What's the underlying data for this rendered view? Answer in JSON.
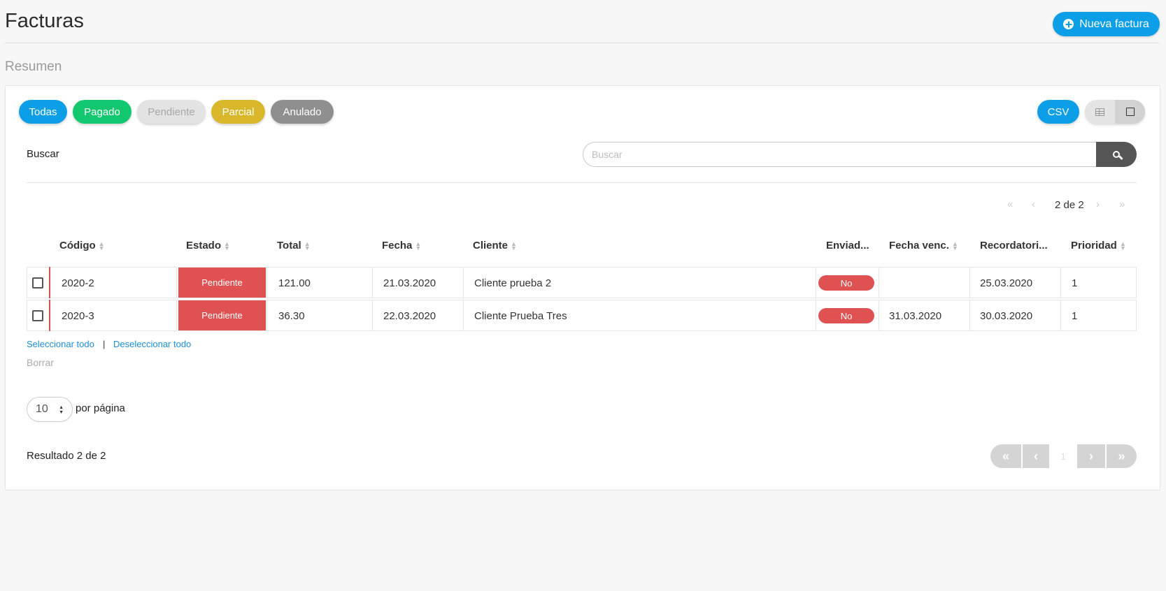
{
  "header": {
    "title": "Facturas",
    "new_button_label": "Nueva factura",
    "new_button_icon": "plus-circle-icon"
  },
  "summary": {
    "label": "Resumen"
  },
  "filters": [
    {
      "label": "Todas",
      "color": "#0d9ee8",
      "text_color": "#ffffff"
    },
    {
      "label": "Pagado",
      "color": "#12c86e",
      "text_color": "#ffffff"
    },
    {
      "label": "Pendiente",
      "color": "#e3e3e3",
      "text_color": "#a8a8a8"
    },
    {
      "label": "Parcial",
      "color": "#d9b72a",
      "text_color": "#ffffff"
    },
    {
      "label": "Anulado",
      "color": "#8f8f8f",
      "text_color": "#ffffff"
    }
  ],
  "toolbar": {
    "csv_label": "CSV",
    "view_table_icon": "table-icon",
    "view_card_icon": "square-icon"
  },
  "search": {
    "label": "Buscar",
    "placeholder": "Buscar",
    "value": "",
    "button_icon": "search-icon"
  },
  "top_pager": {
    "first_icon": "«",
    "prev_icon": "‹",
    "text": "2 de 2",
    "next_icon": "›",
    "last_icon": "»"
  },
  "table": {
    "columns": [
      "Código",
      "Estado",
      "Total",
      "Fecha",
      "Cliente",
      "Enviad...",
      "Fecha venc.",
      "Recordatori...",
      "Prioridad"
    ],
    "sortable_icon": "sort-icon",
    "rows": [
      {
        "codigo": "2020-2",
        "estado": "Pendiente",
        "total": "121.00",
        "fecha": "21.03.2020",
        "cliente": "Cliente prueba 2",
        "enviado": "No",
        "fecha_venc": "",
        "recordatorio": "25.03.2020",
        "prioridad": "1"
      },
      {
        "codigo": "2020-3",
        "estado": "Pendiente",
        "total": "36.30",
        "fecha": "22.03.2020",
        "cliente": "Cliente Prueba Tres",
        "enviado": "No",
        "fecha_venc": "31.03.2020",
        "recordatorio": "30.03.2020",
        "prioridad": "1"
      }
    ],
    "status_color": "#e05252"
  },
  "selection": {
    "select_all": "Seleccionar todo",
    "separator": "|",
    "deselect_all": "Deseleccionar todo",
    "delete_label": "Borrar"
  },
  "per_page": {
    "value": "10",
    "label": "por página"
  },
  "footer": {
    "result_text": "Resultado 2 de 2",
    "pager": {
      "first": "«",
      "prev": "‹",
      "page": "1",
      "next": "›",
      "last": "»"
    }
  }
}
